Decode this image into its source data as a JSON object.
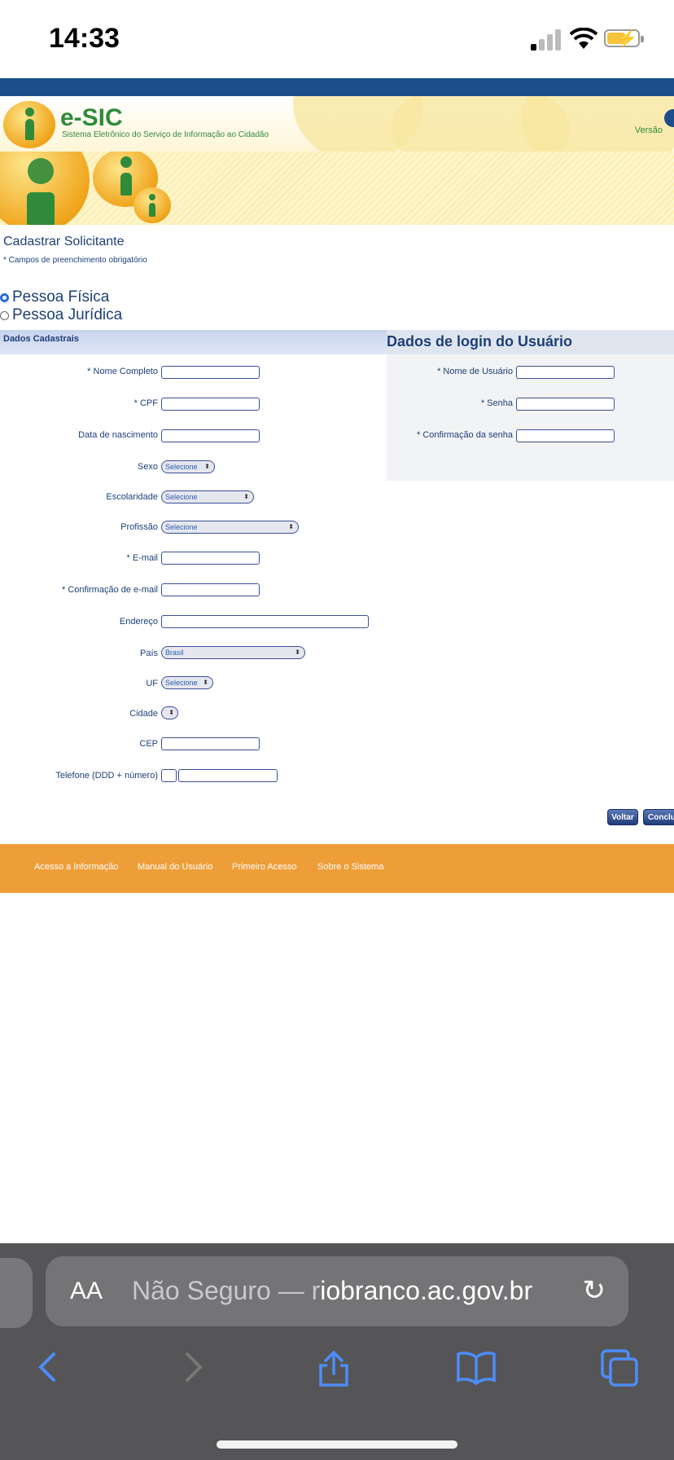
{
  "status_bar": {
    "time": "14:33"
  },
  "header": {
    "brand": "e-SIC",
    "subtitle": "Sistema Eletrônico do Serviço de Informação ao Cidadão",
    "version_link": "Versão"
  },
  "page": {
    "title": "Cadastrar Solicitante",
    "required_note": "* Campos de preenchimento obrigatório"
  },
  "person_type": {
    "options": [
      "Pessoa Física",
      "Pessoa Jurídica"
    ],
    "selected": "Pessoa Física"
  },
  "dados_cadastrais": {
    "heading": "Dados Cadastrais",
    "fields": {
      "nome": "* Nome Completo",
      "cpf": "* CPF",
      "nascimento": "Data de nascimento",
      "sexo": "Sexo",
      "escolaridade": "Escolaridade",
      "profissao": "Profissão",
      "email": "* E-mail",
      "email_confirm": "* Confirmação de e-mail",
      "endereco": "Endereço",
      "pais": "País",
      "uf": "UF",
      "cidade": "Cidade",
      "cep": "CEP",
      "telefone": "Telefone (DDD + número)"
    },
    "selects": {
      "sexo": "Selecione",
      "escolaridade": "Selecione",
      "profissao": "Selecione",
      "pais": "Brasil",
      "uf": "Selecione",
      "cidade": ""
    }
  },
  "login": {
    "heading": "Dados de login do Usuário",
    "fields": {
      "usuario": "* Nome de Usuário",
      "senha": "* Senha",
      "senha_confirm": "* Confirmação da senha"
    }
  },
  "actions": {
    "back": "Voltar",
    "finish": "Conclu"
  },
  "footer": {
    "links": [
      "Acesso a Informação",
      "Manual do Usuário",
      "Primeiro Acesso",
      "Sobre o Sistema"
    ]
  },
  "browser": {
    "aa": "AA",
    "url_prefix": "Não Seguro — r",
    "url_domain": "iobranco.ac.gov.br"
  },
  "colors": {
    "primary": "#1d4e8b",
    "footer": "#ee9e39",
    "brand_green": "#2f8a3a"
  }
}
